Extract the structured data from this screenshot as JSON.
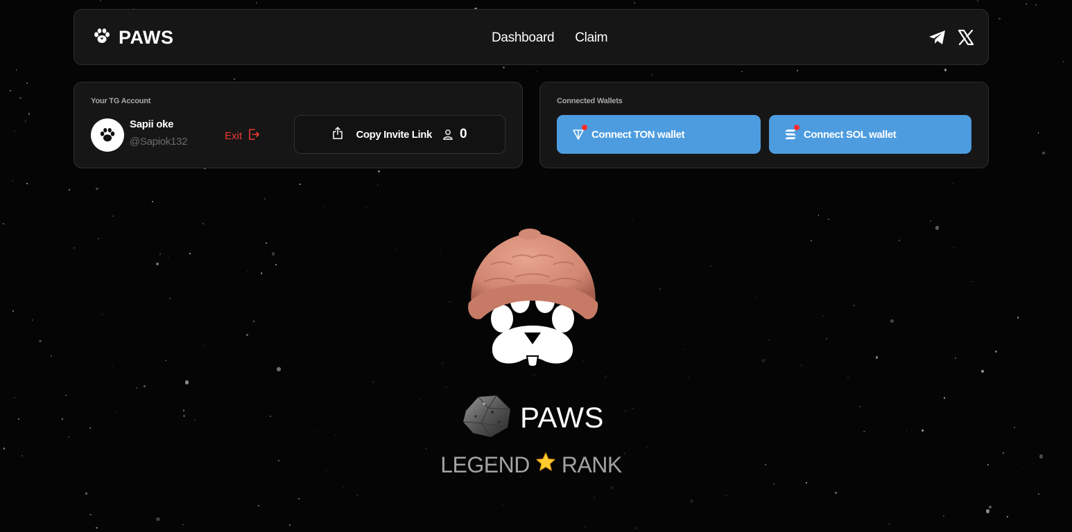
{
  "header": {
    "brand": "PAWS",
    "nav": [
      {
        "label": "Dashboard"
      },
      {
        "label": "Claim"
      }
    ],
    "social_icons": [
      "telegram-icon",
      "x-icon"
    ]
  },
  "account": {
    "label": "Your TG Account",
    "name": "Sapii oke",
    "handle": "@Sapiok132",
    "exit_label": "Exit",
    "invite_label": "Copy Invite Link",
    "invite_count": "0"
  },
  "wallets": {
    "label": "Connected Wallets",
    "ton_label": "Connect TON wallet",
    "sol_label": "Connect SOL wallet"
  },
  "hero": {
    "token_name": "PAWS",
    "rank_left": "LEGEND",
    "rank_right": "RANK",
    "rank_icon": "star-icon"
  },
  "colors": {
    "background": "#050505",
    "panel": "#161616",
    "wallet_button": "#4d9ce0",
    "exit": "#f03a32",
    "notification_dot": "#ff2d2d",
    "hat": "#d98f78"
  }
}
